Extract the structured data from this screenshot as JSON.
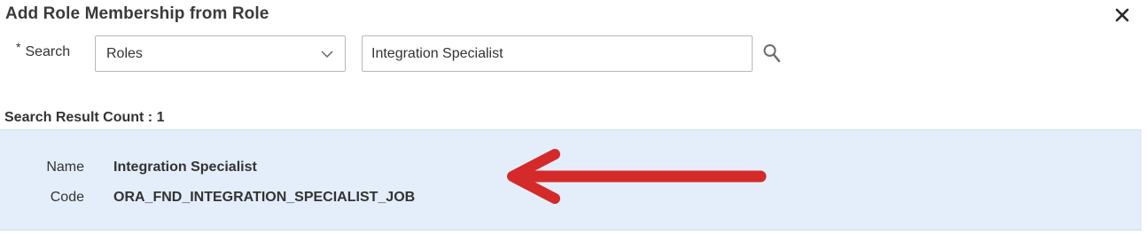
{
  "dialog": {
    "title": "Add Role Membership from Role",
    "close_glyph": "✕"
  },
  "search": {
    "required_marker": "*",
    "label": "Search",
    "type_selected": "Roles",
    "query_value": "Integration Specialist",
    "chevron_icon": "chevron-down-icon",
    "search_icon": "search-icon"
  },
  "results": {
    "count_text": "Search Result Count : 1",
    "items": [
      {
        "name_label": "Name",
        "name_value": "Integration Specialist",
        "code_label": "Code",
        "code_value": "ORA_FND_INTEGRATION_SPECIALIST_JOB"
      }
    ]
  },
  "annotation": {
    "arrow_color": "#d42a2a"
  },
  "colors": {
    "result_highlight": "#e4eefa",
    "text": "#333333",
    "input_border": "#b8b8b8"
  }
}
